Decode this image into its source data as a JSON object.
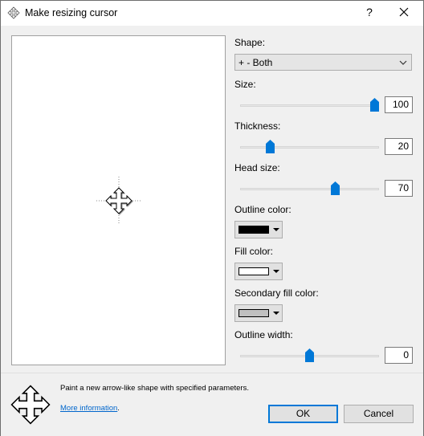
{
  "window": {
    "title": "Make resizing cursor",
    "help_label": "?"
  },
  "shape": {
    "label": "Shape:",
    "value": "+ - Both"
  },
  "size": {
    "label": "Size:",
    "value": "100",
    "level": 1.0
  },
  "thickness": {
    "label": "Thickness:",
    "value": "20",
    "level": 0.2
  },
  "head_size": {
    "label": "Head size:",
    "value": "70",
    "level": 0.7
  },
  "outline_color": {
    "label": "Outline color:",
    "color": "#000000"
  },
  "fill_color": {
    "label": "Fill color:",
    "color": "#ffffff"
  },
  "secondary_fill_color": {
    "label": "Secondary fill color:",
    "color": "#c0c0c0"
  },
  "outline_width": {
    "label": "Outline width:",
    "value": "0",
    "level": 0.5
  },
  "footer": {
    "description": "Paint a new arrow-like shape with specified parameters.",
    "more_info": "More information",
    "more_info_suffix": ".",
    "ok_label": "OK",
    "cancel_label": "Cancel"
  },
  "colors": {
    "accent": "#0078d7",
    "link": "#0066cc"
  }
}
